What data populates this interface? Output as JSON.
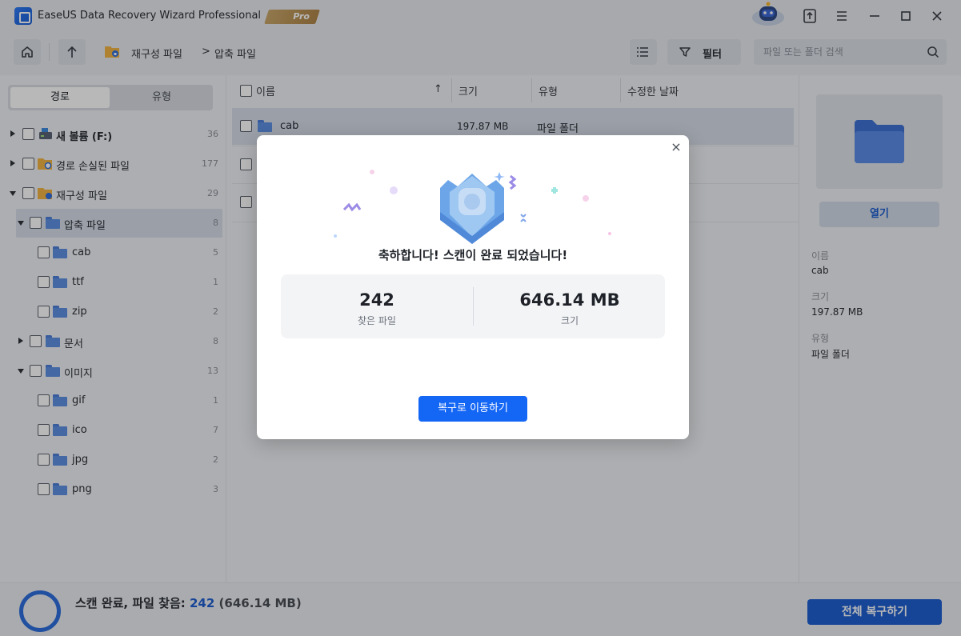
{
  "app": {
    "title": "EaseUS Data Recovery Wizard Professional",
    "badge": "Pro"
  },
  "toolbar": {
    "breadcrumb": [
      "재구성 파일",
      "압축 파일"
    ],
    "breadcrumb_sep": ">",
    "filter_label": "필터",
    "search_placeholder": "파일 또는 폴더 검색"
  },
  "sidebar": {
    "tabs": [
      "경로",
      "유형"
    ],
    "items": [
      {
        "label": "새 볼륨 (F:)",
        "count": "36"
      },
      {
        "label": "경로 손실된 파일",
        "count": "177"
      },
      {
        "label": "재구성 파일",
        "count": "29"
      },
      {
        "label": "압축 파일",
        "count": "8"
      },
      {
        "label": "cab",
        "count": "5"
      },
      {
        "label": "ttf",
        "count": "1"
      },
      {
        "label": "zip",
        "count": "2"
      },
      {
        "label": "문서",
        "count": "8"
      },
      {
        "label": "이미지",
        "count": "13"
      },
      {
        "label": "gif",
        "count": "1"
      },
      {
        "label": "ico",
        "count": "7"
      },
      {
        "label": "jpg",
        "count": "2"
      },
      {
        "label": "png",
        "count": "3"
      }
    ]
  },
  "list": {
    "columns": [
      "이름",
      "크기",
      "유형",
      "수정한 날짜"
    ],
    "sort_arrow": "↑",
    "rows": [
      {
        "name": "cab",
        "size": "197.87 MB",
        "type": "파일 폴더",
        "date": ""
      }
    ]
  },
  "details": {
    "open_label": "열기",
    "name_label": "이름",
    "name_value": "cab",
    "size_label": "크기",
    "size_value": "197.87 MB",
    "type_label": "유형",
    "type_value": "파일 폴더"
  },
  "bottom": {
    "status_prefix": "스캔 완료, 파일 찾음: ",
    "status_count": "242",
    "status_size": "(646.14 MB)",
    "recover_all_label": "전체 복구하기"
  },
  "modal": {
    "headline": "축하합니다! 스캔이 완료 되었습니다!",
    "found_count": "242",
    "found_label": "찾은 파일",
    "size_value": "646.14 MB",
    "size_label": "크기",
    "button_label": "복구로 이동하기",
    "close_glyph": "×"
  },
  "colors": {
    "accent": "#1466f5",
    "brand": "#1f5fd1"
  }
}
